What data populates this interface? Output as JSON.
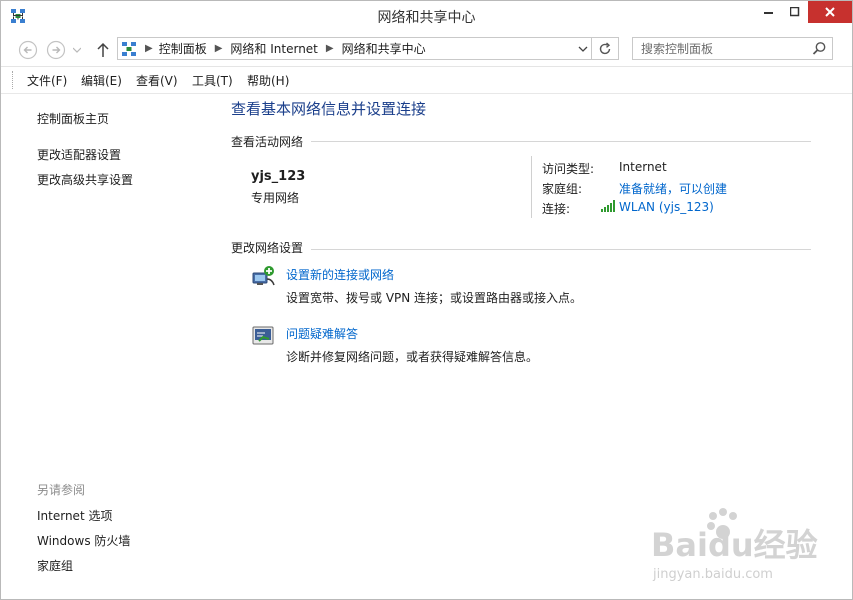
{
  "window": {
    "title": "网络和共享中心"
  },
  "address": {
    "breadcrumbs": [
      "控制面板",
      "网络和 Internet",
      "网络和共享中心"
    ]
  },
  "search": {
    "placeholder": "搜索控制面板"
  },
  "menu": [
    "文件(F)",
    "编辑(E)",
    "查看(V)",
    "工具(T)",
    "帮助(H)"
  ],
  "left": {
    "links": [
      "控制面板主页",
      "更改适配器设置",
      "更改高级共享设置"
    ],
    "see_also_title": "另请参阅",
    "see_also": [
      "Internet 选项",
      "Windows 防火墙",
      "家庭组"
    ]
  },
  "main": {
    "title": "查看基本网络信息并设置连接",
    "active_networks_title": "查看活动网络",
    "network": {
      "name": "yjs_123",
      "type": "专用网络",
      "access_label": "访问类型:",
      "access_value": "Internet",
      "homegroup_label": "家庭组:",
      "homegroup_value": "准备就绪，可以创建",
      "connection_label": "连接:",
      "connection_value": "WLAN (yjs_123)"
    },
    "change_settings_title": "更改网络设置",
    "tasks": [
      {
        "link": "设置新的连接或网络",
        "desc": "设置宽带、拨号或 VPN 连接；或设置路由器或接入点。"
      },
      {
        "link": "问题疑难解答",
        "desc": "诊断并修复网络问题，或者获得疑难解答信息。"
      }
    ]
  },
  "watermark": {
    "brand": "Baidu经验",
    "url": "jingyan.baidu.com"
  },
  "colors": {
    "accent": "#1b3f8b",
    "link": "#0066cc",
    "close": "#c7312e"
  }
}
